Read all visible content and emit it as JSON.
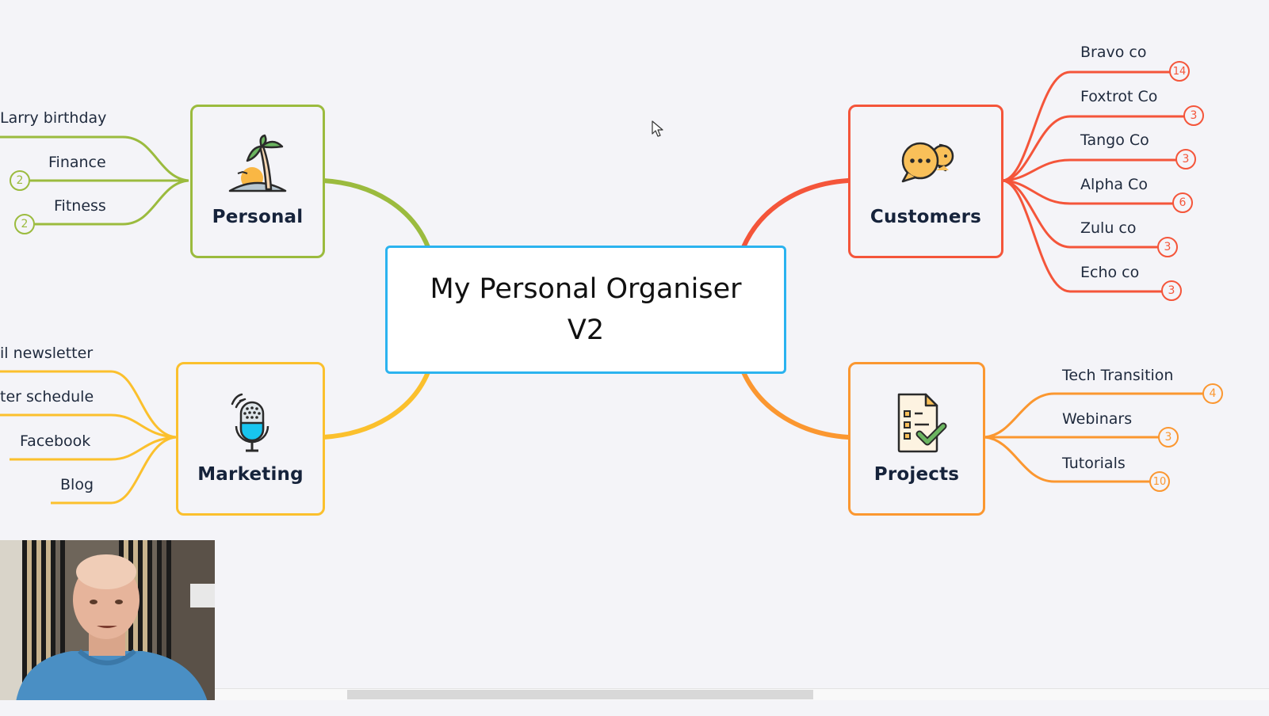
{
  "app": {
    "view": "mind-map"
  },
  "colors": {
    "background": "#f4f4f8",
    "center_border": "#2bb3ef",
    "personal": "#9bbb3e",
    "marketing": "#fbc02d",
    "customers": "#f4553a",
    "projects": "#fb9730",
    "text": "#1f2a3d"
  },
  "center": {
    "title": "My Personal Organiser\nV2"
  },
  "topics": {
    "personal": {
      "label": "Personal",
      "icon": "palm-tree-island-icon",
      "children": [
        {
          "label": "Larry birthday",
          "badge": null
        },
        {
          "label": "Finance",
          "badge": "2"
        },
        {
          "label": "Fitness",
          "badge": "2"
        }
      ]
    },
    "marketing": {
      "label": "Marketing",
      "icon": "microphone-icon",
      "children": [
        {
          "label": "il newsletter",
          "badge": null
        },
        {
          "label": "ter schedule",
          "badge": null
        },
        {
          "label": "Facebook",
          "badge": null
        },
        {
          "label": "Blog",
          "badge": null
        }
      ]
    },
    "customers": {
      "label": "Customers",
      "icon": "chat-bubbles-icon",
      "children": [
        {
          "label": "Bravo co",
          "badge": "14"
        },
        {
          "label": "Foxtrot Co",
          "badge": "3"
        },
        {
          "label": "Tango Co",
          "badge": "3"
        },
        {
          "label": "Alpha Co",
          "badge": "6"
        },
        {
          "label": "Zulu co",
          "badge": "3"
        },
        {
          "label": "Echo co",
          "badge": "3"
        }
      ]
    },
    "projects": {
      "label": "Projects",
      "icon": "checklist-document-icon",
      "children": [
        {
          "label": "Tech Transition",
          "badge": "4"
        },
        {
          "label": "Webinars",
          "badge": "3"
        },
        {
          "label": "Tutorials",
          "badge": "10"
        }
      ]
    }
  },
  "webcam": {
    "label": "presenter-webcam-overlay"
  },
  "scrollbar": {
    "orientation": "horizontal"
  }
}
